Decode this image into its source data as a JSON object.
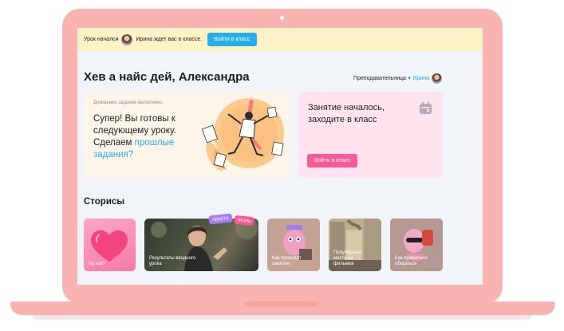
{
  "banner": {
    "lesson_started": "Урок начался",
    "waiting_text": "Ирина ждет вас в классе.",
    "enter_button": "Войти в класс"
  },
  "header": {
    "greeting": "Хев а найс дей, Александра",
    "teacher_role": "Преподавательница",
    "teacher_separator": "•",
    "teacher_name": "Ирина"
  },
  "homework_card": {
    "status": "Домашнее задание выполнено",
    "message": "Супер! Вы готовы к следующему уроку. Сделаем ",
    "link": "прошлые задания?"
  },
  "class_card": {
    "title": "Занятие началось, заходите в класс",
    "enter_button": "Войти в класс",
    "icon": "calendar-icon"
  },
  "stories": {
    "title": "Сторисы",
    "tags": [
      "просто",
      "огонь"
    ],
    "items": [
      {
        "caption": "Ну как?"
      },
      {
        "caption": "Результаты вводного урока"
      },
      {
        "caption": "Как проходят занятия"
      },
      {
        "caption": "Популярные места из фильмов"
      },
      {
        "caption": "Как правильно общаться"
      }
    ]
  },
  "colors": {
    "laptop": "#f9b4b2",
    "accent_blue": "#25aee8",
    "accent_pink": "#f75b95",
    "banner_bg": "#fbf3c6",
    "screen_bg": "#f1f4f8"
  }
}
